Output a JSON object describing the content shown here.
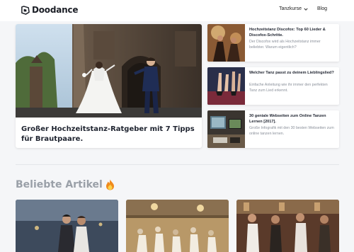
{
  "header": {
    "logo_text": "Doodance",
    "nav": [
      {
        "label": "Tanzkurse",
        "has_dropdown": true
      },
      {
        "label": "Blog",
        "has_dropdown": false
      }
    ]
  },
  "featured": {
    "title": "Großer Hochzeitstanz-Ratgeber mit 7 Tipps für Brautpaare."
  },
  "side_articles": [
    {
      "title": "Hochzeitstanz Discofox: Top 60 Lieder & Discofox-Schritte.",
      "description": "Der Discofox wird als Hochzeitstanz immer beliebter. Warum eigentlich?"
    },
    {
      "title": "Welcher Tanz passt zu deinem Lieblingslied?",
      "description": "Einfache Anleitung wie ihr immer den perfekten Tanz zum Lied erkennt."
    },
    {
      "title": "30 geniale Webseiten zum Online Tanzen Lernen [2017].",
      "description": "Große Infografik mit den 30 besten Webseiten zum online tanzen lernen."
    }
  ],
  "popular": {
    "title": "Beliebte Artikel"
  },
  "colors": {
    "accent": "#1f2430",
    "muted": "#9aa0a8",
    "background": "#f5f6f8"
  }
}
